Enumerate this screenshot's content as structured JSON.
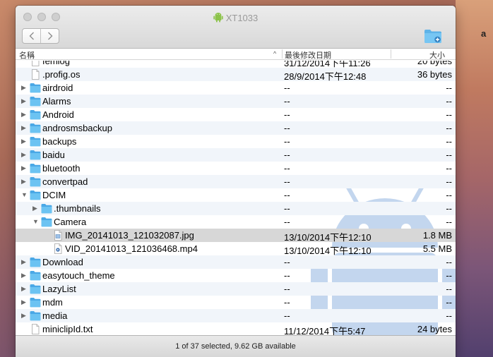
{
  "window": {
    "title": "XT1033"
  },
  "columns": {
    "name": "名稱",
    "modified": "最後修改日期",
    "size": "大小"
  },
  "rows": [
    {
      "name": "femlog",
      "modified": "31/12/2014下午11:26",
      "size": "20 bytes",
      "kind": "file",
      "depth": 0
    },
    {
      "name": ".profig.os",
      "modified": "28/9/2014下午12:48",
      "size": "36 bytes",
      "kind": "file",
      "depth": 0
    },
    {
      "name": "airdroid",
      "modified": "--",
      "size": "--",
      "kind": "folder",
      "depth": 0,
      "expanded": false
    },
    {
      "name": "Alarms",
      "modified": "--",
      "size": "--",
      "kind": "folder",
      "depth": 0,
      "expanded": false
    },
    {
      "name": "Android",
      "modified": "--",
      "size": "--",
      "kind": "folder",
      "depth": 0,
      "expanded": false
    },
    {
      "name": "androsmsbackup",
      "modified": "--",
      "size": "--",
      "kind": "folder",
      "depth": 0,
      "expanded": false
    },
    {
      "name": "backups",
      "modified": "--",
      "size": "--",
      "kind": "folder",
      "depth": 0,
      "expanded": false
    },
    {
      "name": "baidu",
      "modified": "--",
      "size": "--",
      "kind": "folder",
      "depth": 0,
      "expanded": false
    },
    {
      "name": "bluetooth",
      "modified": "--",
      "size": "--",
      "kind": "folder",
      "depth": 0,
      "expanded": false
    },
    {
      "name": "convertpad",
      "modified": "--",
      "size": "--",
      "kind": "folder",
      "depth": 0,
      "expanded": false
    },
    {
      "name": "DCIM",
      "modified": "--",
      "size": "--",
      "kind": "folder",
      "depth": 0,
      "expanded": true
    },
    {
      "name": ".thumbnails",
      "modified": "--",
      "size": "--",
      "kind": "folder",
      "depth": 1,
      "expanded": false
    },
    {
      "name": "Camera",
      "modified": "--",
      "size": "--",
      "kind": "folder",
      "depth": 1,
      "expanded": true
    },
    {
      "name": "IMG_20141013_121032087.jpg",
      "modified": "13/10/2014下午12:10",
      "size": "1.8 MB",
      "kind": "image",
      "depth": 2,
      "selected": true
    },
    {
      "name": "VID_20141013_121036468.mp4",
      "modified": "13/10/2014下午12:10",
      "size": "5.5 MB",
      "kind": "video",
      "depth": 2
    },
    {
      "name": "Download",
      "modified": "--",
      "size": "--",
      "kind": "folder",
      "depth": 0,
      "expanded": false
    },
    {
      "name": "easytouch_theme",
      "modified": "--",
      "size": "--",
      "kind": "folder",
      "depth": 0,
      "expanded": false
    },
    {
      "name": "LazyList",
      "modified": "--",
      "size": "--",
      "kind": "folder",
      "depth": 0,
      "expanded": false
    },
    {
      "name": "mdm",
      "modified": "--",
      "size": "--",
      "kind": "folder",
      "depth": 0,
      "expanded": false
    },
    {
      "name": "media",
      "modified": "--",
      "size": "--",
      "kind": "folder",
      "depth": 0,
      "expanded": false
    },
    {
      "name": "miniclipId.txt",
      "modified": "11/12/2014下午5:47",
      "size": "24 bytes",
      "kind": "file",
      "depth": 0
    }
  ],
  "status": {
    "text": "1 of 37 selected, 9.62 GB available"
  },
  "desktop": {
    "label": "a"
  },
  "colors": {
    "folder": "#6cc3f2",
    "selection": "#d7d7d7",
    "stripe": "#f1f5fa"
  }
}
